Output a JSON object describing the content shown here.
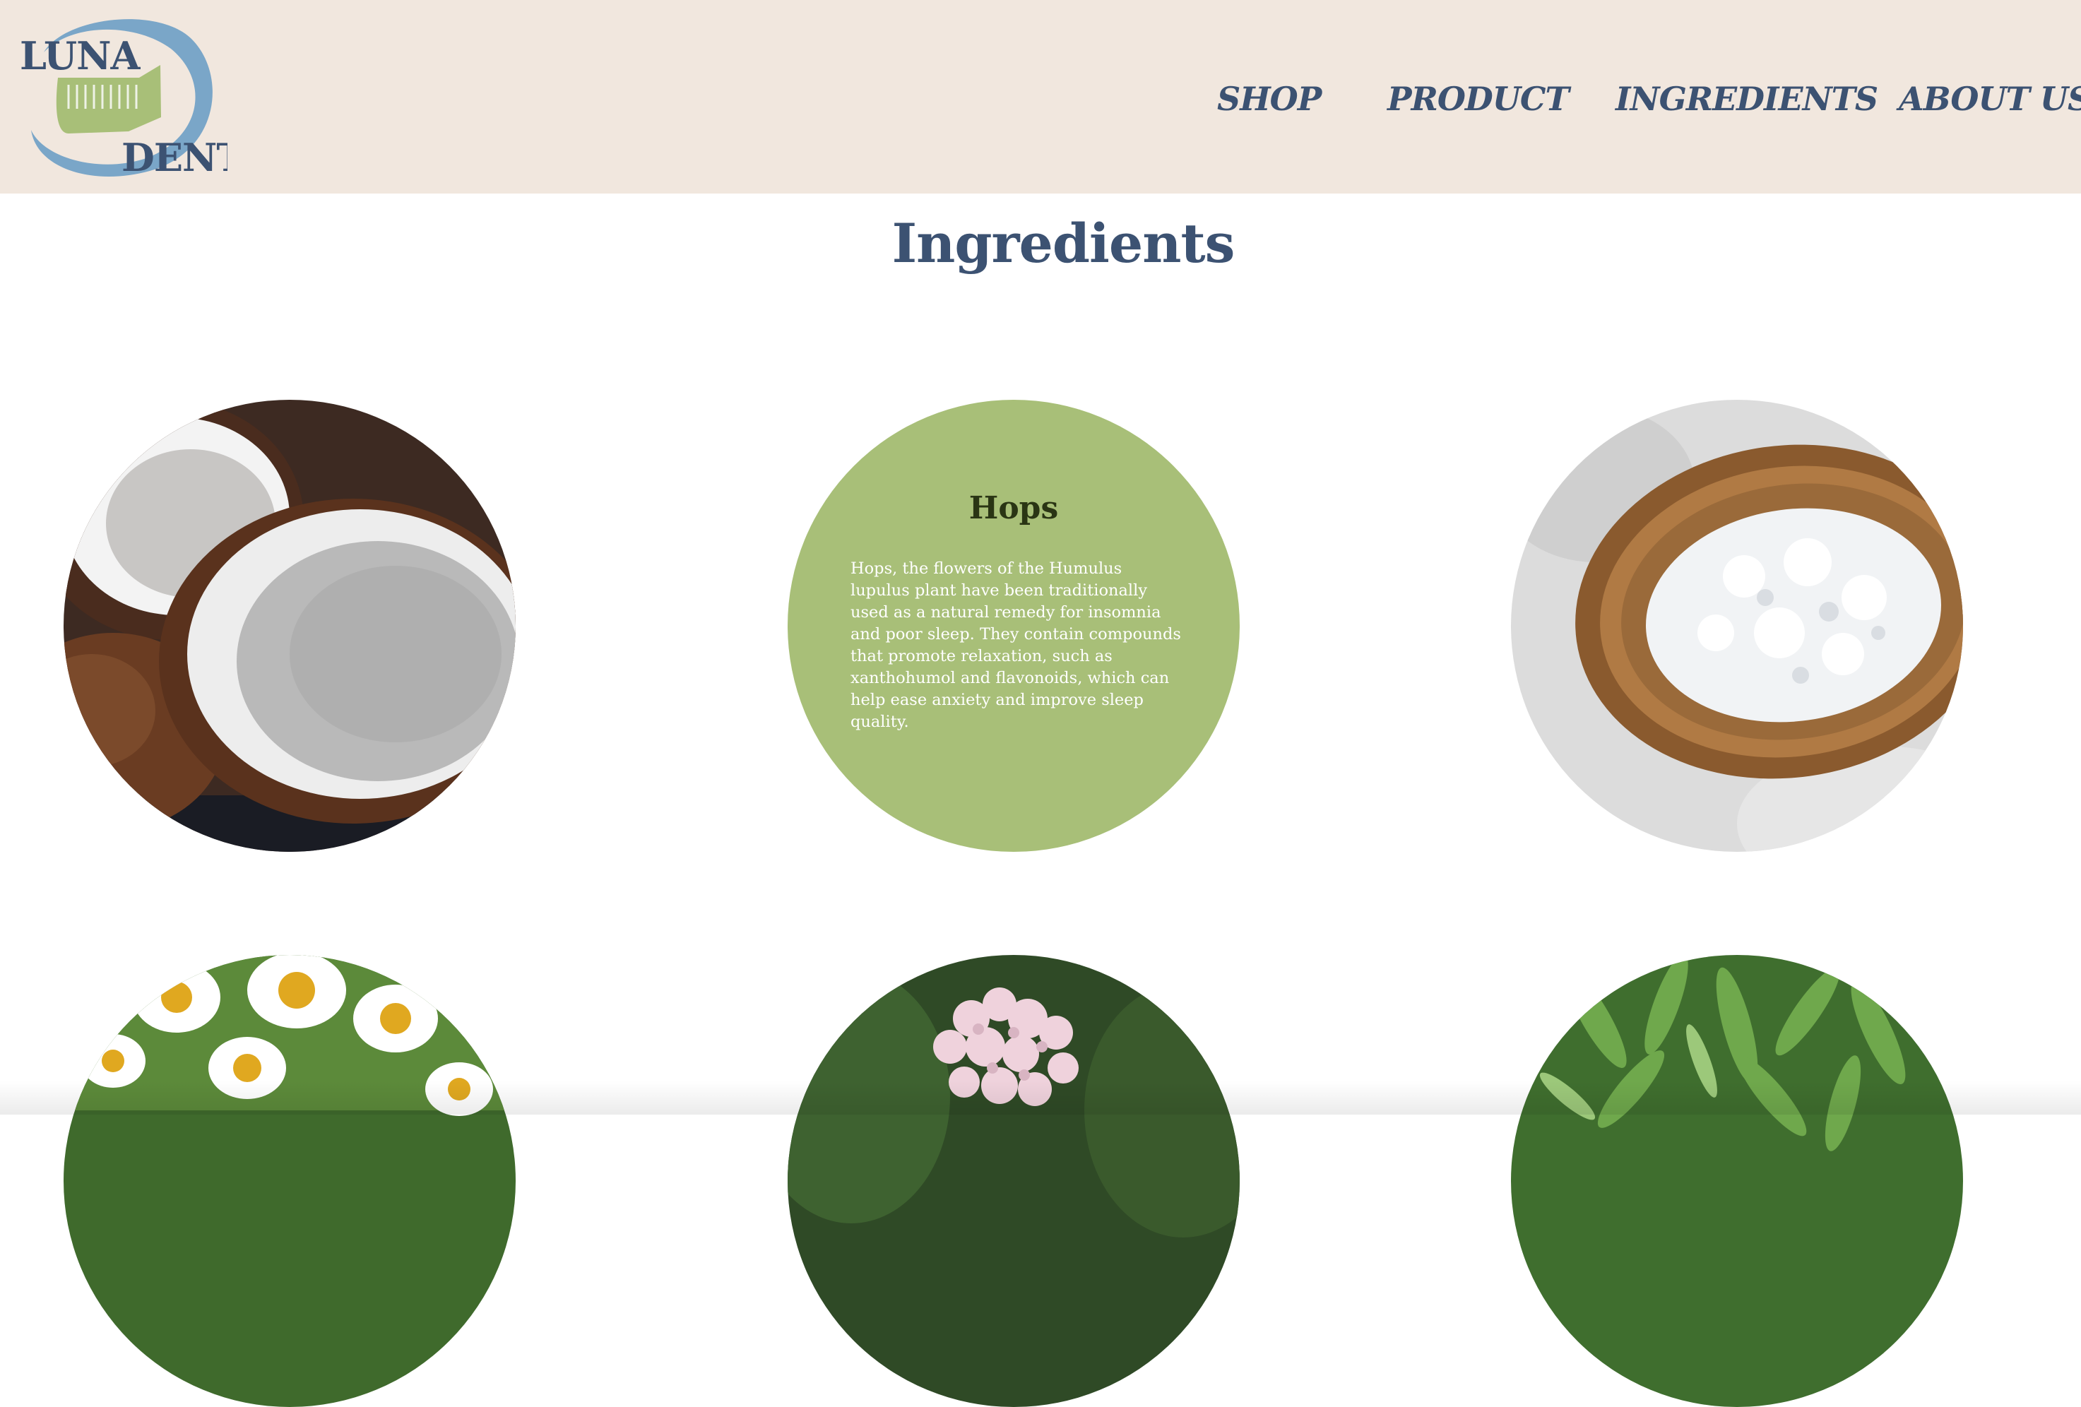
{
  "header": {
    "logo": {
      "text_top": "LUNA",
      "text_bottom": "DENT",
      "icon": "toothpaste-moon-logo"
    },
    "nav": [
      {
        "label": "SHOP"
      },
      {
        "label": "PRODUCT"
      },
      {
        "label": "INGREDIENTS"
      },
      {
        "label": "ABOUT US"
      }
    ]
  },
  "main": {
    "title": "Ingredients",
    "ingredients": [
      {
        "image": "coconut-image"
      },
      {
        "name": "Hops",
        "description": "Hops, the flowers of the Humulus lupulus plant have been traditionally used as a natural remedy for insomnia and poor sleep. They contain compounds that promote relaxation, such as xanthohumol and flavonoids, which can help ease anxiety and improve sleep quality."
      },
      {
        "image": "salt-crystals-image"
      },
      {
        "image": "chamomile-flowers-image"
      },
      {
        "image": "valerian-flowers-image"
      },
      {
        "image": "green-leaves-image"
      }
    ]
  },
  "colors": {
    "header_bg": "#f1e7de",
    "brand_navy": "#3c5272",
    "brand_green": "#a8bf78",
    "logo_blue": "#7aa6c8"
  }
}
